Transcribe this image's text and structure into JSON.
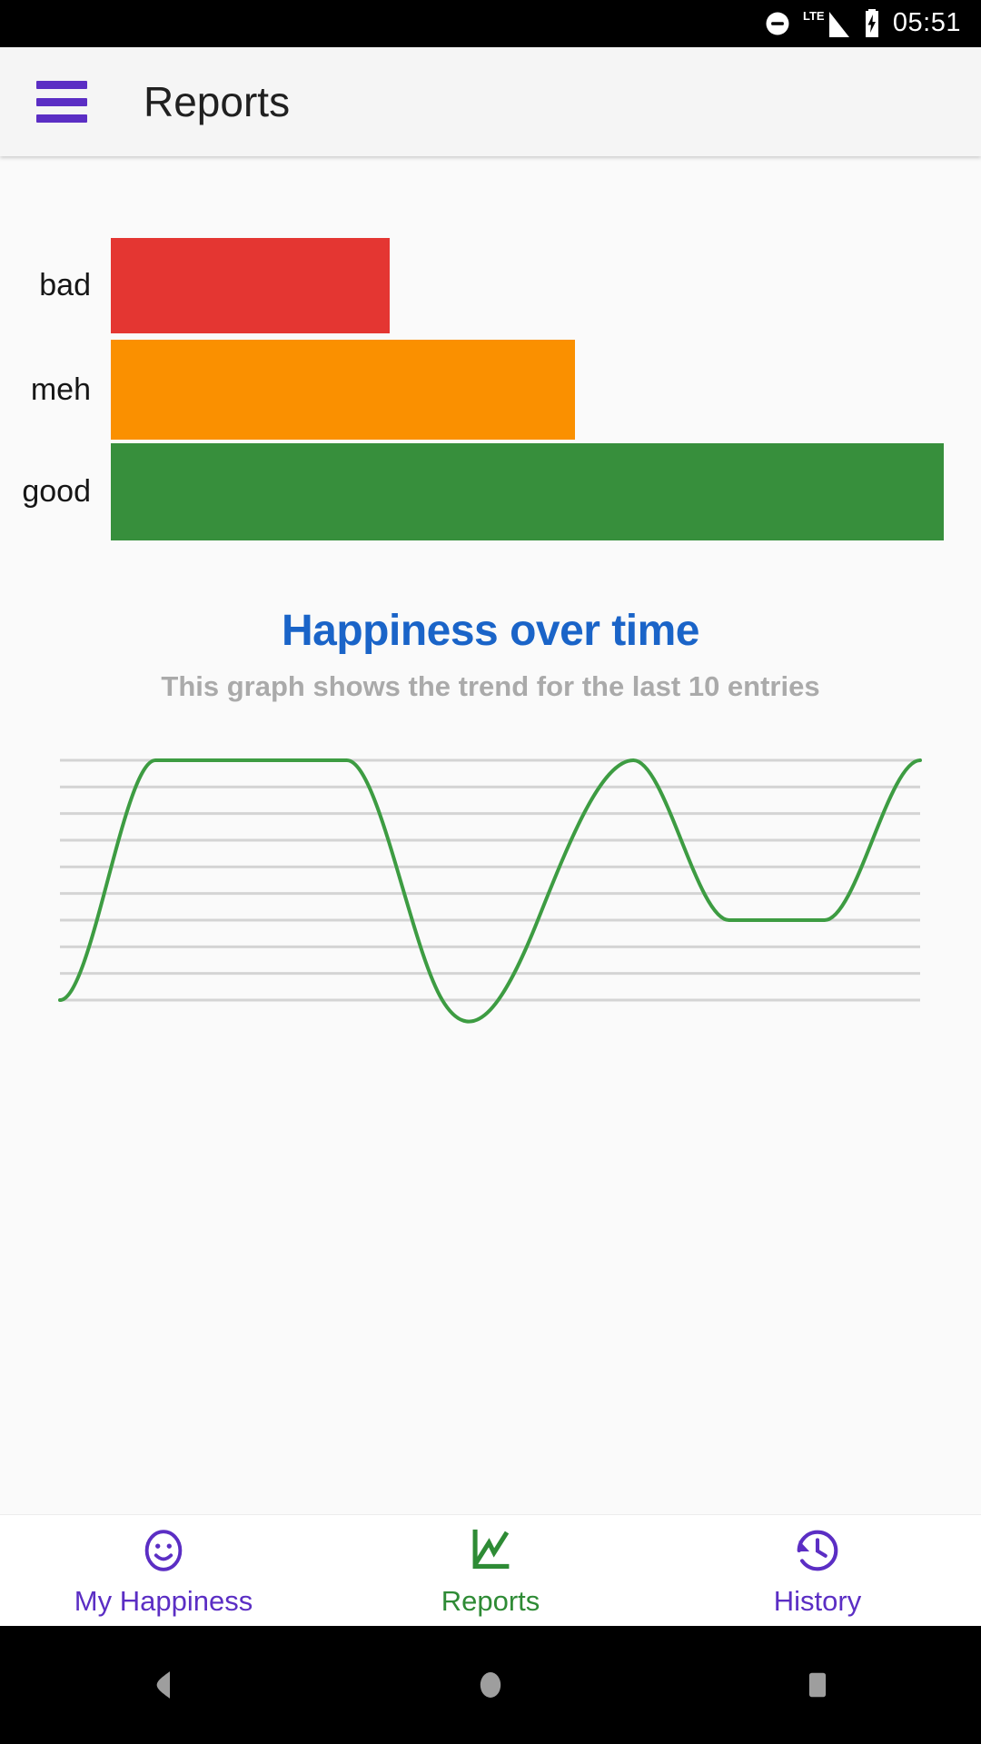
{
  "status_bar": {
    "icons": [
      "do-not-disturb-icon",
      "lte-signal-icon",
      "battery-charging-icon"
    ],
    "lte_label": "LTE",
    "time": "05:51"
  },
  "app_bar": {
    "menu_icon": "hamburger-menu-icon",
    "title": "Reports"
  },
  "mood_summary": {
    "labels": [
      "bad",
      "meh",
      "good"
    ],
    "colors": {
      "bad": "#e43632",
      "meh": "#fa9000",
      "good": "#378f3c"
    }
  },
  "report": {
    "title": "Happiness over time",
    "subtitle": "This graph shows the trend for the last 10 entries",
    "title_color": "#1a64c8",
    "subtitle_color": "#aaaaaa",
    "line_color": "#3d9c42"
  },
  "bottom_nav": {
    "tabs": [
      {
        "label": "My Happiness",
        "icon": "smiley-face-icon",
        "color": "#5b2ec4",
        "active": false
      },
      {
        "label": "Reports",
        "icon": "line-chart-icon",
        "color": "#2e8b35",
        "active": true
      },
      {
        "label": "History",
        "icon": "history-clock-icon",
        "color": "#5b2ec4",
        "active": false
      }
    ]
  },
  "android_nav": {
    "buttons": [
      "back-button",
      "home-button",
      "recents-button"
    ]
  },
  "chart_data": [
    {
      "type": "bar",
      "orientation": "horizontal",
      "title": "",
      "categories": [
        "bad",
        "meh",
        "good"
      ],
      "values": [
        33,
        55,
        100
      ],
      "unit": "percent of maximum bar length",
      "colors": [
        "#e43632",
        "#fa9000",
        "#378f3c"
      ],
      "xlabel": "",
      "ylabel": "",
      "grid": false,
      "legend": "none"
    },
    {
      "type": "line",
      "title": "Happiness over time",
      "subtitle": "This graph shows the trend for the last 10 entries",
      "xlabel": "",
      "ylabel": "",
      "x": [
        1,
        2,
        3,
        4,
        5,
        6,
        7,
        8,
        9,
        10
      ],
      "series": [
        {
          "name": "happiness",
          "color": "#3d9c42",
          "values": [
            0,
            9,
            9,
            9,
            0,
            3,
            9,
            3,
            3,
            9
          ]
        }
      ],
      "ylim": [
        0,
        9
      ],
      "y_gridlines": [
        0,
        1,
        2,
        3,
        4,
        5,
        6,
        7,
        8,
        9
      ],
      "grid": true,
      "grid_color": "#d4d4d4",
      "axis_ticks_visible": false,
      "legend": "none",
      "interpolation": "smooth-monotone"
    }
  ]
}
